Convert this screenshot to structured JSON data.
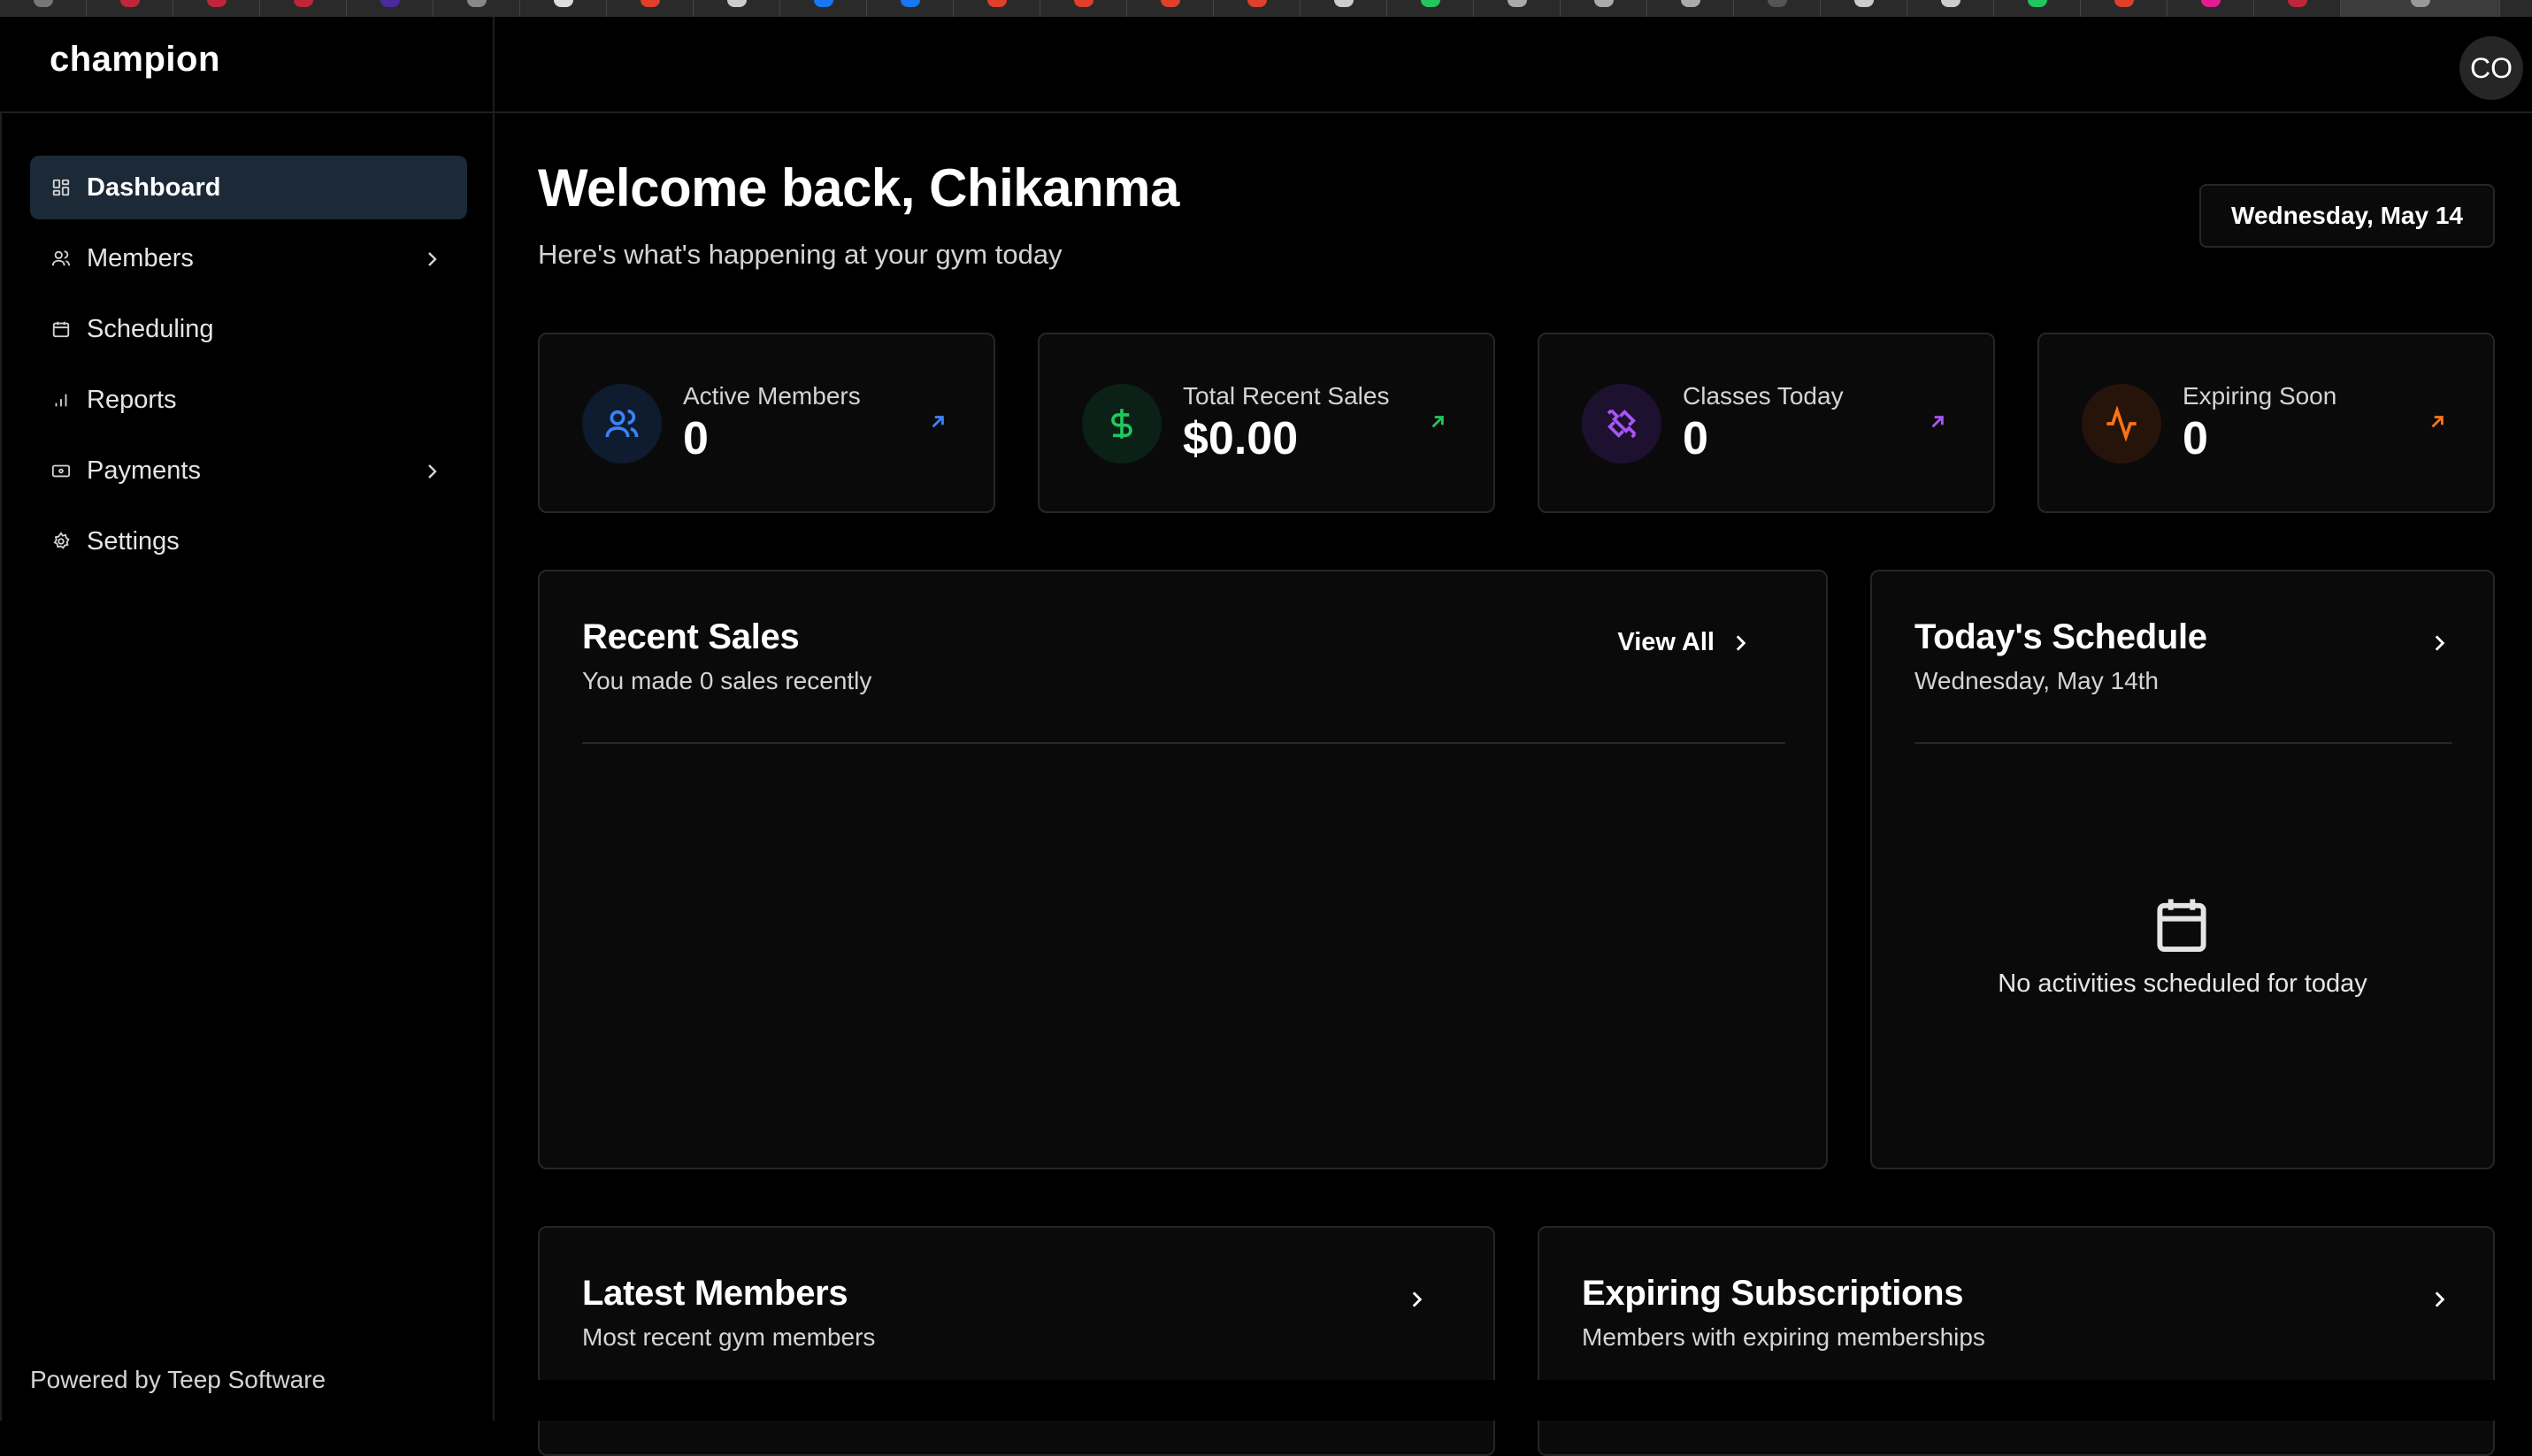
{
  "colors": {
    "accent_blue": "#3b82f6",
    "accent_green": "#22c55e",
    "accent_purple": "#a855f7",
    "accent_orange": "#f97316"
  },
  "header": {
    "brand": "champion",
    "avatar_initials": "CO"
  },
  "sidebar": {
    "items": [
      {
        "label": "Dashboard",
        "icon": "dashboard-grid-icon",
        "active": true
      },
      {
        "label": "Members",
        "icon": "users-icon",
        "has_submenu": true
      },
      {
        "label": "Scheduling",
        "icon": "calendar-icon"
      },
      {
        "label": "Reports",
        "icon": "bar-chart-icon"
      },
      {
        "label": "Payments",
        "icon": "credit-card-icon",
        "has_submenu": true
      },
      {
        "label": "Settings",
        "icon": "gear-icon"
      }
    ],
    "footer": "Powered by Teep Software"
  },
  "main": {
    "welcome": "Welcome back, Chikanma",
    "subtitle": "Here's what's happening at your gym today",
    "date_button": "Wednesday, May 14",
    "stats": [
      {
        "label": "Active Members",
        "value": "0",
        "icon": "users-icon"
      },
      {
        "label": "Total Recent Sales",
        "value": "$0.00",
        "icon": "dollar-icon"
      },
      {
        "label": "Classes Today",
        "value": "0",
        "icon": "dumbbell-icon"
      },
      {
        "label": "Expiring Soon",
        "value": "0",
        "icon": "activity-icon"
      }
    ],
    "recent_sales": {
      "title": "Recent Sales",
      "subtitle": "You made 0 sales recently",
      "view_all": "View All"
    },
    "todays_schedule": {
      "title": "Today's Schedule",
      "subtitle": "Wednesday, May 14th",
      "empty": "No activities scheduled for today"
    },
    "latest_members": {
      "title": "Latest Members",
      "subtitle": "Most recent gym members"
    },
    "expiring_subscriptions": {
      "title": "Expiring Subscriptions",
      "subtitle": "Members with expiring memberships"
    }
  }
}
